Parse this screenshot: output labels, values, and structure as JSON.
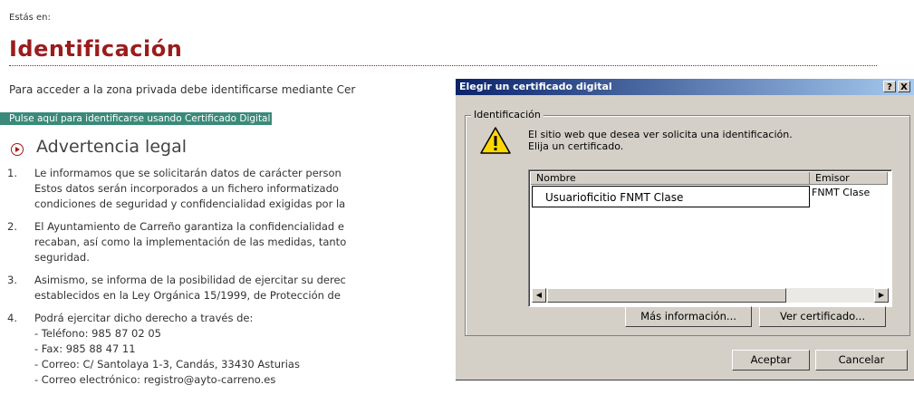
{
  "page": {
    "breadcrumb": "Estás en:",
    "title": "Identificación",
    "intro": "Para acceder a la zona privada debe identificarse mediante Cer",
    "cert_link": "Pulse aquí para identificarse usando Certificado Digital",
    "advertencia_title": "Advertencia legal",
    "legal_items": [
      {
        "num": "1.",
        "lines": [
          "Le informamos que se solicitarán datos de carácter person",
          "Estos datos serán incorporados a un fichero informatizado",
          "condiciones de seguridad y confidencialidad exigidas por la"
        ]
      },
      {
        "num": "2.",
        "lines": [
          "El Ayuntamiento de Carreño garantiza la confidencialidad e",
          "recaban, así como la implementación de las medidas, tanto",
          "seguridad."
        ]
      },
      {
        "num": "3.",
        "lines": [
          "Asimismo, se informa de la posibilidad de ejercitar su derec",
          "establecidos en la Ley Orgánica 15/1999, de Protección de"
        ]
      },
      {
        "num": "4.",
        "lines": [
          "Podrá ejercitar dicho derecho a través de:",
          "- Teléfono: 985 87 02 05",
          "- Fax: 985 88 47 11",
          "- Correo: C/ Santolaya 1-3, Candás, 33430 Asturias",
          "- Correo electrónico: registro@ayto-carreno.es"
        ]
      }
    ]
  },
  "dialog": {
    "title": "Elegir un certificado digital",
    "help_btn": "?",
    "close_btn": "X",
    "group_label": "Identificación",
    "message_line1": "El sitio web que desea ver solicita una identificación.",
    "message_line2": "Elija un certificado.",
    "columns": {
      "name": "Nombre",
      "issuer": "Emisor"
    },
    "row": {
      "name": "Usuarioficitio FNMT Clase",
      "issuer": "FNMT Clase"
    },
    "more_info_btn": "Más información...",
    "view_cert_btn": "Ver certificado...",
    "accept_btn": "Aceptar",
    "cancel_btn": "Cancelar"
  }
}
